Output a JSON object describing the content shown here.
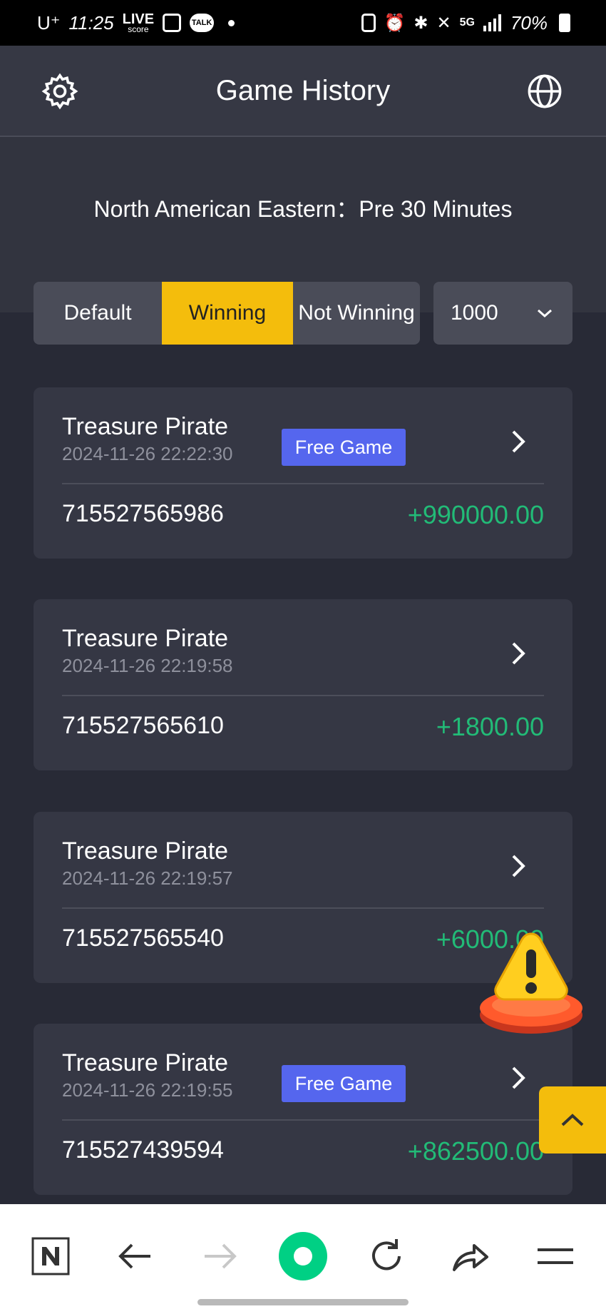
{
  "status_bar": {
    "carrier": "U⁺",
    "time": "11:25",
    "live_score": "LIVE",
    "live_score_sub": "score",
    "talk": "TALK",
    "network": "5G",
    "battery": "70%"
  },
  "header": {
    "title": "Game History",
    "settings_icon": "gear-icon",
    "language_icon": "globe-icon"
  },
  "timezone_text": "North American Eastern：Pre 30 Minutes",
  "filters": {
    "tabs": [
      {
        "label": "Default",
        "active": false
      },
      {
        "label": "Winning",
        "active": true
      },
      {
        "label": "Not Winning",
        "active": false
      }
    ],
    "count_select": "1000"
  },
  "records": [
    {
      "game": "Treasure Pirate",
      "datetime": "2024-11-26 22:22:30",
      "badge": "Free Game",
      "id": "715527565986",
      "amount": "+990000.00"
    },
    {
      "game": "Treasure Pirate",
      "datetime": "2024-11-26 22:19:58",
      "badge": "",
      "id": "715527565610",
      "amount": "+1800.00"
    },
    {
      "game": "Treasure Pirate",
      "datetime": "2024-11-26 22:19:57",
      "badge": "",
      "id": "715527565540",
      "amount": "+6000.00"
    },
    {
      "game": "Treasure Pirate",
      "datetime": "2024-11-26 22:19:55",
      "badge": "Free Game",
      "id": "715527439594",
      "amount": "+862500.00"
    }
  ],
  "colors": {
    "accent": "#f4bd0c",
    "win_amount": "#22bb77",
    "badge": "#5566ee",
    "card": "#353744",
    "browser_home": "#00d084"
  }
}
